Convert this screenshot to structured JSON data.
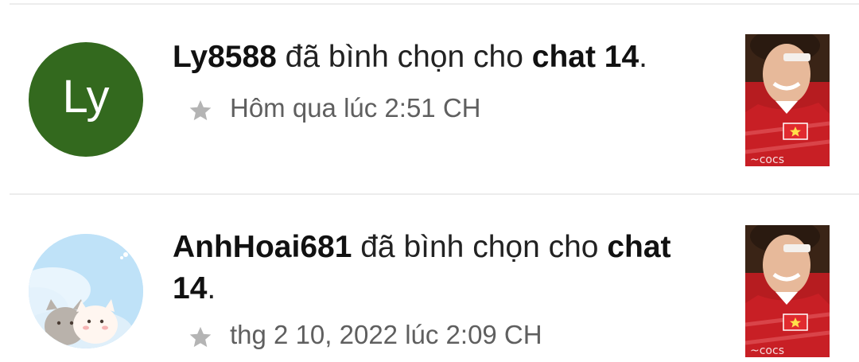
{
  "notifications": [
    {
      "avatar_letters": "Ly",
      "avatar_color": "#33691e",
      "user": "Ly8588",
      "action": " đã bình chọn cho ",
      "target": "chat 14",
      "end": ".",
      "time": "Hôm qua lúc 2:51 CH",
      "icon": "star-icon"
    },
    {
      "avatar_image": "cartoon-cats-sky",
      "user": "AnhHoai681",
      "action": " đã bình chọn cho ",
      "target": "chat 14",
      "end": ".",
      "time": "thg 2 10, 2022 lúc 2:09 CH",
      "icon": "star-icon"
    }
  ]
}
